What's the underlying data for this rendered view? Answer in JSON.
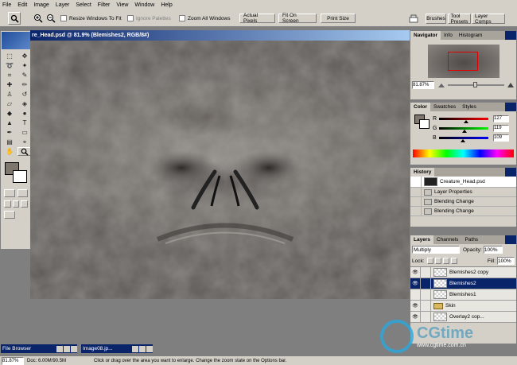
{
  "menu": [
    "File",
    "Edit",
    "Image",
    "Layer",
    "Select",
    "Filter",
    "View",
    "Window",
    "Help"
  ],
  "options": {
    "resize_label": "Resize Windows To Fit",
    "ignore_palettes_label": "Ignore Palettes",
    "zoom_all_label": "Zoom All Windows",
    "actual_pixels": "Actual Pixels",
    "fit_on_screen": "Fit On Screen",
    "print_size": "Print Size"
  },
  "wells": [
    "Brushes",
    "Tool Presets",
    "Layer Comps"
  ],
  "document": {
    "title": "re_Head.psd @ 81.9% (Blemishes2, RGB/8#)"
  },
  "navigator": {
    "tabs": [
      "Navigator",
      "Info",
      "Histogram"
    ],
    "zoom": "81.87%"
  },
  "color": {
    "tabs": [
      "Color",
      "Swatches",
      "Styles"
    ],
    "channels": [
      {
        "label": "R",
        "value": "127",
        "pos": 0.5
      },
      {
        "label": "G",
        "value": "119",
        "pos": 0.47
      },
      {
        "label": "B",
        "value": "109",
        "pos": 0.43
      }
    ]
  },
  "history": {
    "tabs": [
      "History"
    ],
    "items": [
      "Creature_Head.psd",
      "Layer Properties",
      "Blending Change",
      "Blending Change"
    ]
  },
  "layers": {
    "tabs": [
      "Layers",
      "Channels",
      "Paths"
    ],
    "blend": "Multiply",
    "opacity_label": "Opacity:",
    "opacity": "100%",
    "lock_label": "Lock:",
    "fill_label": "Fill:",
    "fill": "100%",
    "rows": [
      {
        "name": "Blemishes2 copy",
        "selected": false,
        "visible": true
      },
      {
        "name": "Blemishes2",
        "selected": true,
        "visible": true
      },
      {
        "name": "Blemishes1",
        "selected": false,
        "visible": false
      },
      {
        "name": "Skin",
        "selected": false,
        "visible": true,
        "folder": true
      },
      {
        "name": "Overlay2 cop...",
        "selected": false,
        "visible": true
      }
    ]
  },
  "minimized": [
    "File Browser",
    "Image08.jp..."
  ],
  "status": {
    "zoom": "81.87%",
    "doc": "Doc: 6.00M/90.5M",
    "hint": "Click or drag over the area you want to enlarge. Change the zoom state on the Options bar."
  },
  "watermark": {
    "brand": "CGtime",
    "url": "www.cgtime.com.cn"
  }
}
